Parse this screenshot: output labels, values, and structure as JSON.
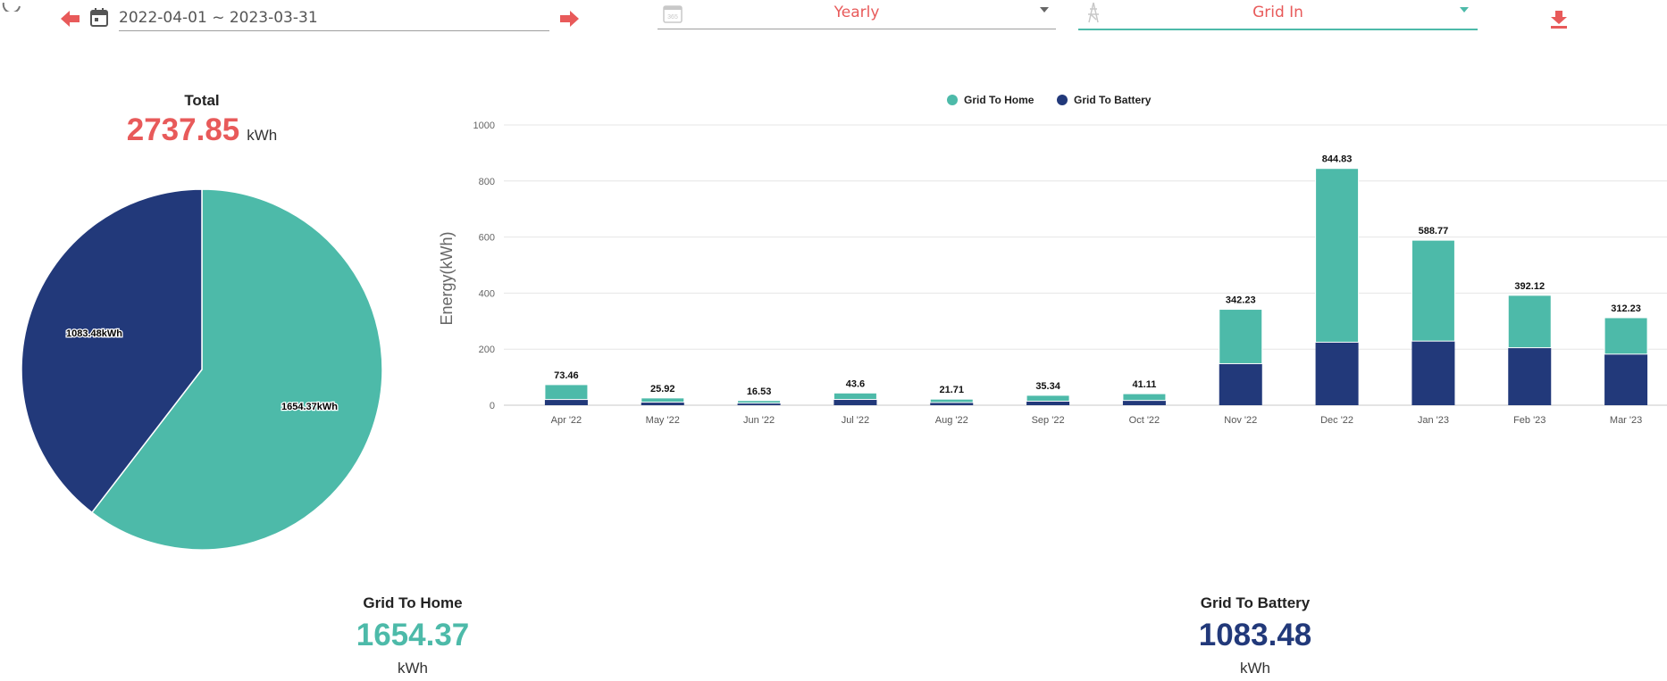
{
  "toolbar": {
    "date_range": "2022-04-01 ~ 2023-03-31",
    "period_select": "Yearly",
    "type_select": "Grid In"
  },
  "colors": {
    "accent": "#e85a5a",
    "grid_to_home": "#4dbaa9",
    "grid_to_battery": "#22397a"
  },
  "total": {
    "label": "Total",
    "value": "2737.85",
    "unit": "kWh"
  },
  "pie": {
    "labels": [
      "1083.48kWh",
      "1654.37kWh"
    ]
  },
  "summary": [
    {
      "label": "Grid To Home",
      "value": "1654.37",
      "unit": "kWh"
    },
    {
      "label": "Grid To Battery",
      "value": "1083.48",
      "unit": "kWh"
    }
  ],
  "chart_data": [
    {
      "type": "pie",
      "slices": [
        {
          "name": "Grid To Home",
          "value": 1654.37,
          "label": "1654.37kWh"
        },
        {
          "name": "Grid To Battery",
          "value": 1083.48,
          "label": "1083.48kWh"
        }
      ]
    },
    {
      "type": "bar",
      "stacked": true,
      "categories": [
        "Apr '22",
        "May '22",
        "Jun '22",
        "Jul '22",
        "Aug '22",
        "Sep '22",
        "Oct '22",
        "Nov '22",
        "Dec '22",
        "Jan '23",
        "Feb '23",
        "Mar '23"
      ],
      "series": [
        {
          "name": "Grid To Home",
          "values": [
            53,
            15,
            9,
            23,
            12,
            21,
            24,
            194,
            620,
            360,
            187,
            130
          ]
        },
        {
          "name": "Grid To Battery",
          "values": [
            20.46,
            10.92,
            7.53,
            20.6,
            9.71,
            14.34,
            17.11,
            148.23,
            224.83,
            228.77,
            205.12,
            182.23
          ]
        }
      ],
      "totals": [
        "73.46",
        "25.92",
        "16.53",
        "43.6",
        "21.71",
        "35.34",
        "41.11",
        "342.23",
        "844.83",
        "588.77",
        "392.12",
        "312.23"
      ],
      "ylabel": "Energy(kWh)",
      "ylim": [
        0,
        1000
      ],
      "yticks": [
        "0",
        "200",
        "400",
        "600",
        "800",
        "1000"
      ],
      "legend": "top-center",
      "grid": true
    }
  ]
}
